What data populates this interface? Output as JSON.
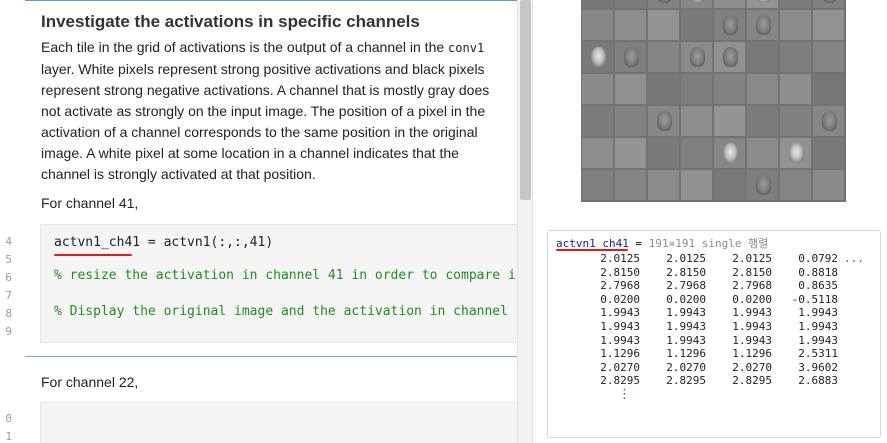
{
  "gutter": {
    "line_numbers": [
      "4",
      "5",
      "6",
      "7",
      "8",
      "9",
      "0",
      "1"
    ]
  },
  "text_section": {
    "title": "Investigate the activations in specific channels",
    "para_part1": "Each tile in the grid of activations is the output of a channel in the ",
    "para_code": "conv1",
    "para_part2": " layer. White pixels represent strong positive activations and black pixels represent strong negative activations. A channel that is mostly gray does not activate as strongly on the input image. The position of a pixel in the activation of a channel corresponds to the same position in the original image. A white pixel at some location in a channel indicates that the channel is strongly activated at that position.",
    "channel41_label": "For channel 41,"
  },
  "code_block": {
    "line1_var": "actvn1_ch41",
    "line1_rest": " = actvn1(:,:,41)",
    "line2": "% resize the activation in channel 41 in order to compare i",
    "line3": "% Display the original image and the activation in channel "
  },
  "text_section2": {
    "channel22_label": "For channel 22,"
  },
  "output": {
    "variable_name": "actvn1_ch41",
    "equals": " = ",
    "variable_meta": "191×191 single 행렬",
    "matrix_rows": [
      [
        "2.0125",
        "2.0125",
        "2.0125",
        "0.0792"
      ],
      [
        "2.8150",
        "2.8150",
        "2.8150",
        "0.8818"
      ],
      [
        "2.7968",
        "2.7968",
        "2.7968",
        "0.8635"
      ],
      [
        "0.0200",
        "0.0200",
        "0.0200",
        "-0.5118"
      ],
      [
        "1.9943",
        "1.9943",
        "1.9943",
        "1.9943"
      ],
      [
        "1.9943",
        "1.9943",
        "1.9943",
        "1.9943"
      ],
      [
        "1.9943",
        "1.9943",
        "1.9943",
        "1.9943"
      ],
      [
        "1.1296",
        "1.1296",
        "1.1296",
        "2.5311"
      ],
      [
        "2.0270",
        "2.0270",
        "2.0270",
        "3.9602"
      ],
      [
        "2.8295",
        "2.8295",
        "2.8295",
        "2.6883"
      ]
    ],
    "row_ellipsis": "...",
    "col_vdots": "⋮"
  },
  "montage": {
    "face_tiles": [
      2,
      3,
      5,
      7,
      12,
      13,
      16,
      17,
      19,
      20,
      34,
      39,
      44,
      46,
      53,
      56
    ],
    "bright_tiles": [
      3,
      5,
      16,
      44,
      46
    ]
  },
  "colors": {
    "annotation_red": "#e21a1a",
    "divider_blue": "#5b9bd5",
    "comment_green": "#228b22"
  }
}
